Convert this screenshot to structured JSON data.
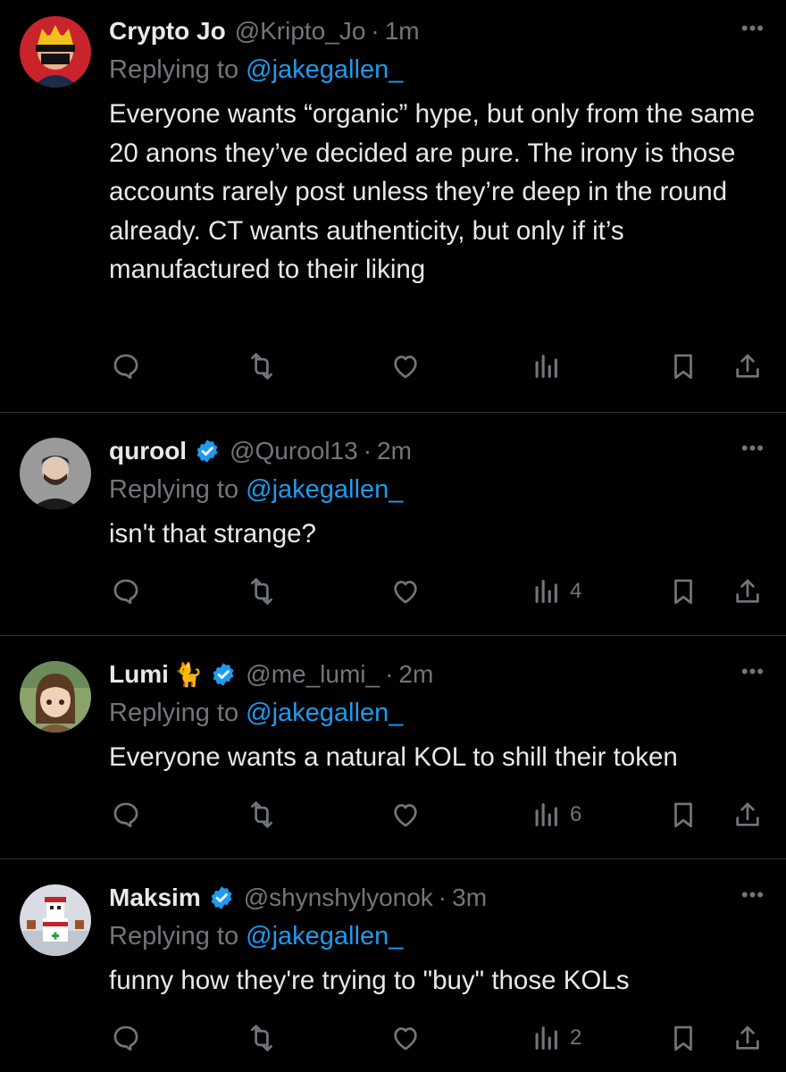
{
  "replies": [
    {
      "name": "Crypto Jo",
      "handle": "@Kripto_Jo",
      "time": "1m",
      "verified": false,
      "emoji": "",
      "replying_prefix": "Replying to ",
      "replying_to": "@jakegallen_",
      "text": "Everyone wants “organic” hype, but only from the same 20 anons they’ve decided are pure. The irony is those accounts rarely post unless they’re deep in the round already. CT wants authenticity, but only if it’s manufactured to their liking",
      "views": ""
    },
    {
      "name": "qurool",
      "handle": "@Qurool13",
      "time": "2m",
      "verified": true,
      "emoji": "",
      "replying_prefix": "Replying to ",
      "replying_to": "@jakegallen_",
      "text": "isn't that strange?",
      "views": "4"
    },
    {
      "name": "Lumi",
      "handle": "@me_lumi_",
      "time": "2m",
      "verified": true,
      "emoji": "🐈",
      "replying_prefix": "Replying to ",
      "replying_to": "@jakegallen_",
      "text": "Everyone wants a natural KOL to shill their token",
      "views": "6"
    },
    {
      "name": "Maksim",
      "handle": "@shynshylyonok",
      "time": "3m",
      "verified": true,
      "emoji": "",
      "replying_prefix": "Replying to ",
      "replying_to": "@jakegallen_",
      "text": "funny how they're trying to \"buy\" those KOLs",
      "views": "2"
    }
  ],
  "separator": "·",
  "more_glyph": "•••",
  "icons": {
    "reply": "reply-icon",
    "retweet": "retweet-icon",
    "like": "like-icon",
    "views": "views-icon",
    "bookmark": "bookmark-icon",
    "share": "share-icon",
    "verified": "verified-badge-icon"
  },
  "colors": {
    "background": "#000000",
    "text": "#e7e9ea",
    "muted": "#71767b",
    "accent": "#1d9bf0",
    "divider": "#2f3336"
  }
}
